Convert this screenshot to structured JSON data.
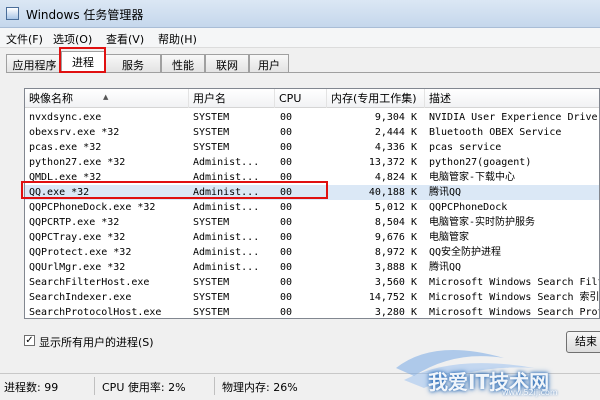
{
  "window": {
    "title": "Windows 任务管理器"
  },
  "menu": [
    "文件(F)",
    "选项(O)",
    "查看(V)",
    "帮助(H)"
  ],
  "tabs": [
    "应用程序",
    "进程",
    "服务",
    "性能",
    "联网",
    "用户"
  ],
  "active_tab": "进程",
  "columns": {
    "name": "映像名称",
    "user": "用户名",
    "cpu": "CPU",
    "memory": "内存(专用工作集)",
    "description": "描述"
  },
  "processes": [
    {
      "name": "nvxdsync.exe",
      "user": "SYSTEM",
      "cpu": "00",
      "memory": "9,304 K",
      "description": "NVIDIA User Experience Driver C"
    },
    {
      "name": "obexsrv.exe *32",
      "user": "SYSTEM",
      "cpu": "00",
      "memory": "2,444 K",
      "description": "Bluetooth OBEX Service"
    },
    {
      "name": "pcas.exe *32",
      "user": "SYSTEM",
      "cpu": "00",
      "memory": "4,336 K",
      "description": "pcas service"
    },
    {
      "name": "python27.exe *32",
      "user": "Administ...",
      "cpu": "00",
      "memory": "13,372 K",
      "description": "python27(goagent)"
    },
    {
      "name": "QMDL.exe *32",
      "user": "Administ...",
      "cpu": "00",
      "memory": "4,824 K",
      "description": "电脑管家-下载中心"
    },
    {
      "name": "QQ.exe *32",
      "user": "Administ...",
      "cpu": "00",
      "memory": "40,188 K",
      "description": "腾讯QQ"
    },
    {
      "name": "QQPCPhoneDock.exe *32",
      "user": "Administ...",
      "cpu": "00",
      "memory": "5,012 K",
      "description": "QQPCPhoneDock"
    },
    {
      "name": "QQPCRTP.exe *32",
      "user": "SYSTEM",
      "cpu": "00",
      "memory": "8,504 K",
      "description": "电脑管家-实时防护服务"
    },
    {
      "name": "QQPCTray.exe *32",
      "user": "Administ...",
      "cpu": "00",
      "memory": "9,676 K",
      "description": "电脑管家"
    },
    {
      "name": "QQProtect.exe *32",
      "user": "Administ...",
      "cpu": "00",
      "memory": "8,972 K",
      "description": "QQ安全防护进程"
    },
    {
      "name": "QQUrlMgr.exe *32",
      "user": "Administ...",
      "cpu": "00",
      "memory": "3,888 K",
      "description": "腾讯QQ"
    },
    {
      "name": "SearchFilterHost.exe",
      "user": "SYSTEM",
      "cpu": "00",
      "memory": "3,560 K",
      "description": "Microsoft Windows Search Filter"
    },
    {
      "name": "SearchIndexer.exe",
      "user": "SYSTEM",
      "cpu": "00",
      "memory": "14,752 K",
      "description": "Microsoft Windows Search 索引器"
    },
    {
      "name": "SearchProtocolHost.exe",
      "user": "SYSTEM",
      "cpu": "00",
      "memory": "3,280 K",
      "description": "Microsoft Windows Search Protoc"
    }
  ],
  "selected_process": "QQ.exe *32",
  "show_all_users": {
    "checked": true,
    "label": "显示所有用户的进程(S)"
  },
  "end_process_button": "结束",
  "status": {
    "processes": "进程数: 99",
    "cpu": "CPU 使用率: 2%",
    "memory": "物理内存: 26%"
  },
  "watermark": {
    "text": "我爱IT技术网",
    "url": "www.52ij.com"
  },
  "colors": {
    "highlight_box": "#e01010",
    "selected_row": "#dbe8f6"
  }
}
